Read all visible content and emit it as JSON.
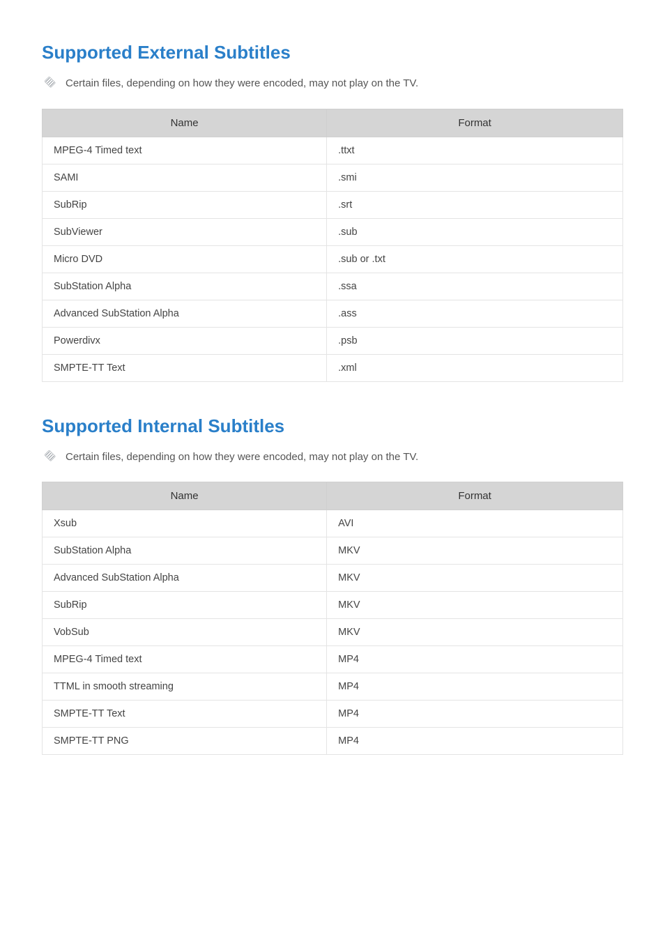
{
  "sections": [
    {
      "title": "Supported External Subtitles",
      "note": "Certain files, depending on how they were encoded, may not play on the TV.",
      "headers": [
        "Name",
        "Format"
      ],
      "rows": [
        [
          "MPEG-4 Timed text",
          ".ttxt"
        ],
        [
          "SAMI",
          ".smi"
        ],
        [
          "SubRip",
          ".srt"
        ],
        [
          "SubViewer",
          ".sub"
        ],
        [
          "Micro DVD",
          ".sub or .txt"
        ],
        [
          "SubStation Alpha",
          ".ssa"
        ],
        [
          "Advanced SubStation Alpha",
          ".ass"
        ],
        [
          "Powerdivx",
          ".psb"
        ],
        [
          "SMPTE-TT Text",
          ".xml"
        ]
      ]
    },
    {
      "title": "Supported Internal Subtitles",
      "note": "Certain files, depending on how they were encoded, may not play on the TV.",
      "headers": [
        "Name",
        "Format"
      ],
      "rows": [
        [
          "Xsub",
          "AVI"
        ],
        [
          "SubStation Alpha",
          "MKV"
        ],
        [
          "Advanced SubStation Alpha",
          "MKV"
        ],
        [
          "SubRip",
          "MKV"
        ],
        [
          "VobSub",
          "MKV"
        ],
        [
          "MPEG-4 Timed text",
          "MP4"
        ],
        [
          "TTML in smooth streaming",
          "MP4"
        ],
        [
          "SMPTE-TT Text",
          "MP4"
        ],
        [
          "SMPTE-TT PNG",
          "MP4"
        ]
      ]
    }
  ]
}
